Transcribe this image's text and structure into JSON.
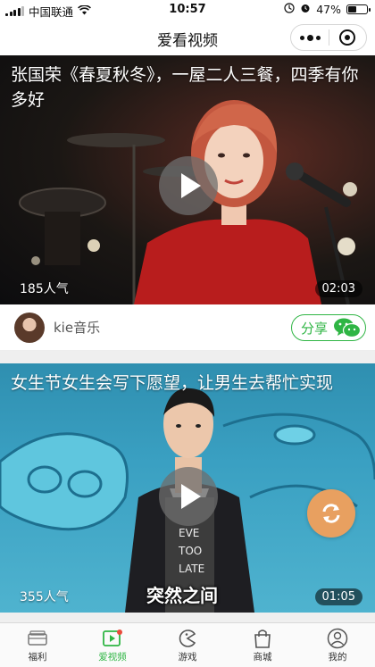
{
  "status_bar": {
    "carrier": "中国联通",
    "time": "10:57",
    "battery": "47%",
    "battery_level": 0.47
  },
  "nav": {
    "title": "爱看视频"
  },
  "videos": [
    {
      "title": "张国荣《春夏秋冬》，一屋二人三餐，四季有你多好",
      "views": "185人气",
      "duration": "02:03",
      "author": "kie音乐",
      "share_label": "分享"
    },
    {
      "title": "女生节女生会写下愿望，让男生去帮忙实现",
      "views": "355人气",
      "duration": "01:05",
      "caption": "突然之间"
    }
  ],
  "tabs": [
    {
      "label": "福利",
      "icon": "gift-card-icon",
      "active": false
    },
    {
      "label": "爱视频",
      "icon": "video-play-icon",
      "active": true
    },
    {
      "label": "游戏",
      "icon": "game-pacman-icon",
      "active": false
    },
    {
      "label": "商城",
      "icon": "shopping-bag-icon",
      "active": false
    },
    {
      "label": "我的",
      "icon": "user-profile-icon",
      "active": false
    }
  ],
  "colors": {
    "accent": "#2fb544",
    "sync_button": "#e8a060"
  }
}
